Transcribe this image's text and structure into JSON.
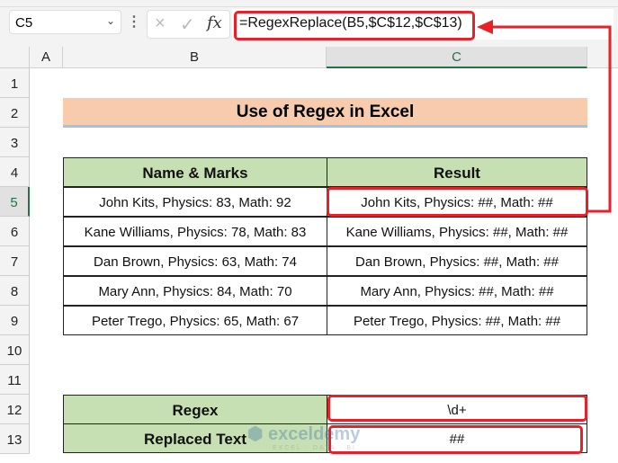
{
  "formula_bar": {
    "name_box": "C5",
    "cancel_icon": "×",
    "enter_icon": "✓",
    "fx_label": "fx",
    "formula": "=RegexReplace(B5,$C$12,$C$13)"
  },
  "columns": [
    "A",
    "B",
    "C"
  ],
  "rows": [
    "1",
    "2",
    "3",
    "4",
    "5",
    "6",
    "7",
    "8",
    "9",
    "10",
    "11",
    "12",
    "13"
  ],
  "title": "Use of Regex in Excel",
  "table": {
    "headers": [
      "Name & Marks",
      "Result"
    ],
    "rows": [
      [
        "John Kits, Physics: 83, Math: 92",
        "John Kits, Physics: ##, Math: ##"
      ],
      [
        "Kane Williams, Physics: 78, Math: 83",
        "Kane Williams, Physics: ##, Math: ##"
      ],
      [
        "Dan Brown, Physics: 63, Math: 74",
        "Dan Brown, Physics: ##, Math: ##"
      ],
      [
        "Mary Ann, Physics: 84, Math: 70",
        "Mary Ann, Physics: ##, Math: ##"
      ],
      [
        "Peter Trego, Physics: 65, Math: 67",
        "Peter Trego, Physics: ##, Math: ##"
      ]
    ]
  },
  "params": [
    {
      "label": "Regex",
      "value": "\\d+"
    },
    {
      "label": "Replaced Text",
      "value": "##"
    }
  ],
  "watermark": {
    "name": "exceldemy",
    "tagline": "EXCEL · DATA · BI"
  },
  "colors": {
    "highlight": "#e8202a",
    "header_green": "#c6e0b4",
    "title_orange": "#f8cbad"
  }
}
